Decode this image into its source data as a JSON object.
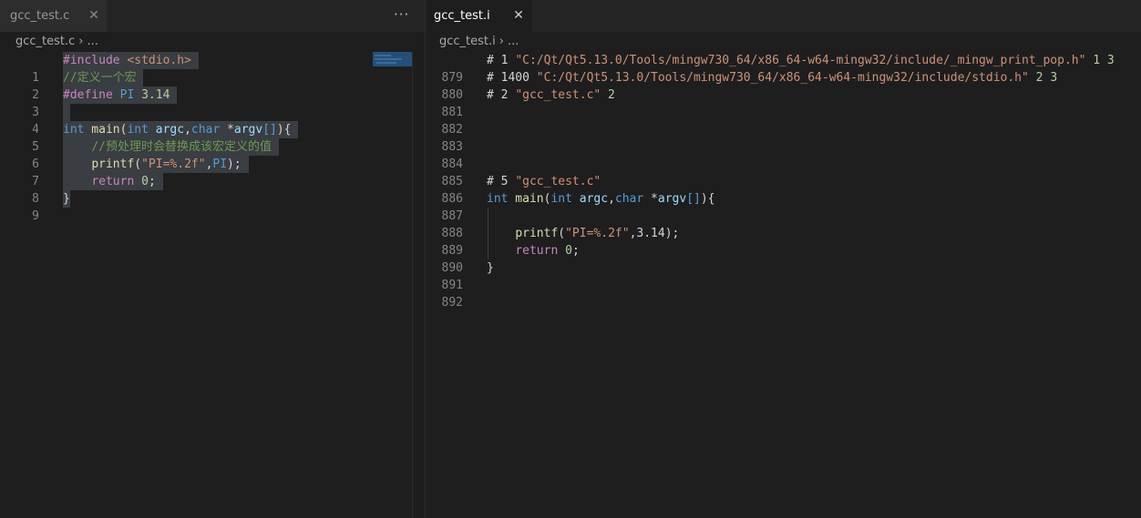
{
  "left": {
    "tab": {
      "label": "gcc_test.c",
      "close": "✕"
    },
    "more_actions": "···",
    "breadcrumb": {
      "file": "gcc_test.c",
      "sep": "›",
      "rest": "..."
    },
    "line_numbers": [
      "1",
      "2",
      "3",
      "4",
      "5",
      "6",
      "7",
      "8",
      "9"
    ],
    "code": {
      "l1": {
        "a": "#include",
        "b": " <stdio.h>"
      },
      "l2": {
        "a": "//定义一个宏"
      },
      "l3": {
        "a": "#define",
        "b": " PI",
        "c": " 3.14"
      },
      "l5": {
        "a": "int",
        "b": " main",
        "c": "(",
        "d": "int",
        "e": " argc",
        "f": ",",
        "g": "char",
        "h": " *",
        "i": "argv",
        "j": "[]",
        "k": "){"
      },
      "l6": {
        "a": "//预处理时会替换成该宏定义的值"
      },
      "l7": {
        "a": "printf",
        "b": "(",
        "c": "\"PI=%.2f\"",
        "d": ",",
        "e": "PI",
        "f": ");"
      },
      "l8": {
        "a": "return",
        "b": " 0",
        "c": ";"
      },
      "l9": {
        "a": "}"
      }
    }
  },
  "right": {
    "tab": {
      "label": "gcc_test.i",
      "close": "✕"
    },
    "breadcrumb": {
      "file": "gcc_test.i",
      "sep": "›",
      "rest": "..."
    },
    "line_numbers": [
      "879",
      "880",
      "881",
      "882",
      "883",
      "884",
      "885",
      "886",
      "887",
      "888",
      "889",
      "890",
      "891",
      "892"
    ],
    "code": {
      "l879": {
        "a": "# 1 ",
        "b": "\"C:/Qt/Qt5.13.0/Tools/mingw730_64/x86_64-w64-mingw32/include/_mingw_print_pop.h\"",
        "c": " 1 3"
      },
      "l880": {
        "a": "# 1400 ",
        "b": "\"C:/Qt/Qt5.13.0/Tools/mingw730_64/x86_64-w64-mingw32/include/stdio.h\"",
        "c": " 2 3"
      },
      "l881": {
        "a": "# 2 ",
        "b": "\"gcc_test.c\"",
        "c": " 2"
      },
      "l886": {
        "a": "# 5 ",
        "b": "\"gcc_test.c\""
      },
      "l887": {
        "a": "int",
        "b": " main",
        "c": "(",
        "d": "int",
        "e": " argc",
        "f": ",",
        "g": "char",
        "h": " *",
        "i": "argv",
        "j": "[]",
        "k": "){"
      },
      "l889": {
        "a": "printf",
        "b": "(",
        "c": "\"PI=%.2f\"",
        "d": ",3.14);"
      },
      "l890": {
        "a": "return",
        "b": " 0",
        "c": ";"
      },
      "l891": {
        "a": "}"
      }
    }
  },
  "colors": {
    "background": "#1e1e1e",
    "keyword": "#569cd6",
    "preprocessor": "#c586c0",
    "comment": "#6a9955",
    "function": "#dcdcaa",
    "variable": "#9cdcfe",
    "string": "#ce9178",
    "number": "#b5cea8",
    "selection": "#3a3d41"
  }
}
